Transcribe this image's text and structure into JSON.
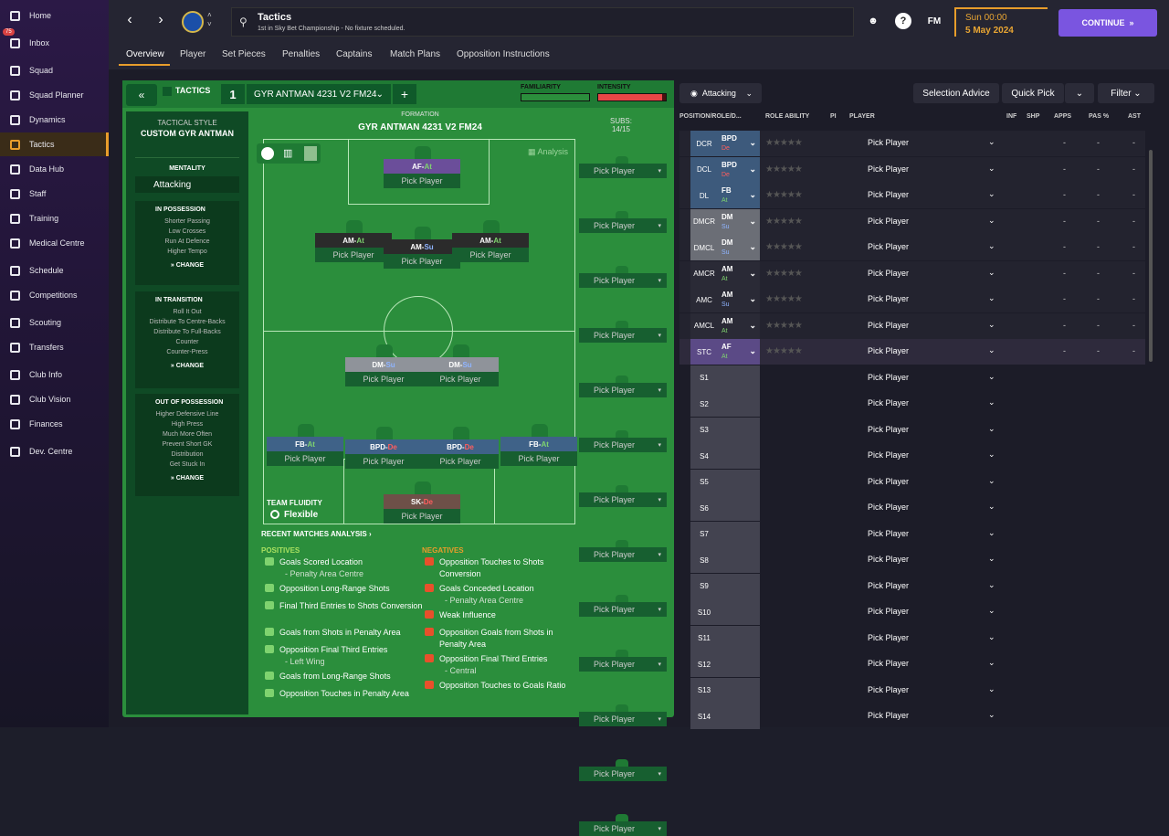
{
  "sidebar": {
    "items": [
      {
        "label": "Home",
        "icon": "home-icon",
        "active": false
      },
      {
        "label": "Inbox",
        "icon": "inbox-icon",
        "active": false,
        "badge": "75"
      },
      {
        "label": "Squad",
        "icon": "squad-icon",
        "active": false
      },
      {
        "label": "Squad Planner",
        "icon": "planner-icon",
        "active": false
      },
      {
        "label": "Dynamics",
        "icon": "dynamics-icon",
        "active": false
      },
      {
        "label": "Tactics",
        "icon": "tactics-icon",
        "active": true
      },
      {
        "label": "Data Hub",
        "icon": "data-hub-icon",
        "active": false
      },
      {
        "label": "Staff",
        "icon": "staff-icon",
        "active": false
      },
      {
        "label": "Training",
        "icon": "training-icon",
        "active": false
      },
      {
        "label": "Medical Centre",
        "icon": "medical-icon",
        "active": false
      },
      {
        "label": "Schedule",
        "icon": "schedule-icon",
        "active": false
      },
      {
        "label": "Competitions",
        "icon": "trophy-icon",
        "active": false
      },
      {
        "label": "Scouting",
        "icon": "scouting-icon",
        "active": false
      },
      {
        "label": "Transfers",
        "icon": "transfers-icon",
        "active": false
      },
      {
        "label": "Club Info",
        "icon": "club-info-icon",
        "active": false
      },
      {
        "label": "Club Vision",
        "icon": "club-vision-icon",
        "active": false
      },
      {
        "label": "Finances",
        "icon": "finances-icon",
        "active": false
      },
      {
        "label": "Dev. Centre",
        "icon": "dev-centre-icon",
        "active": false
      }
    ]
  },
  "header": {
    "title": "Tactics",
    "subtitle": "1st in Sky Bet Championship - No fixture scheduled.",
    "fm_label": "FM",
    "help_label": "?",
    "time": "Sun 00:00",
    "date": "5 May 2024",
    "continue_label": "CONTINUE"
  },
  "tabs": [
    "Overview",
    "Player",
    "Set Pieces",
    "Penalties",
    "Captains",
    "Match Plans",
    "Opposition Instructions"
  ],
  "tactic": {
    "label": "TACTICS",
    "slot": "1",
    "name": "GYR ANTMAN 4231 V2 FM24",
    "familiarity_label": "FAMILIARITY",
    "intensity_label": "INTENSITY",
    "intensity_level": 0.95,
    "style_label": "TACTICAL STYLE",
    "style_name": "CUSTOM GYR ANTMAN",
    "mentality_label": "MENTALITY",
    "mentality": "Attacking",
    "formation_label": "FORMATION",
    "subs_label": "SUBS:",
    "subs_count": "14/15",
    "analysis_label": "Analysis",
    "fluidity_label": "TEAM FLUIDITY",
    "fluidity": "Flexible",
    "change_label": "CHANGE"
  },
  "phases": [
    {
      "title": "IN POSSESSION",
      "items": [
        "Shorter Passing",
        "Low Crosses",
        "Run At Defence",
        "Higher Tempo"
      ]
    },
    {
      "title": "IN TRANSITION",
      "items": [
        "Roll It Out",
        "Distribute To Centre-Backs",
        "Distribute To Full-Backs",
        "Counter",
        "Counter-Press"
      ]
    },
    {
      "title": "OUT OF POSSESSION",
      "items": [
        "Higher Defensive Line",
        "High Press",
        "Much More Often",
        "Prevent Short GK",
        "Distribution",
        "Get Stuck In"
      ]
    }
  ],
  "pitch_players": [
    {
      "role": "AF",
      "duty": "At",
      "pick": "Pick Player"
    },
    {
      "role": "AM",
      "duty": "At",
      "pick": "Pick Player"
    },
    {
      "role": "AM",
      "duty": "Su",
      "pick": "Pick Player"
    },
    {
      "role": "AM",
      "duty": "At",
      "pick": "Pick Player"
    },
    {
      "role": "DM",
      "duty": "Su",
      "pick": "Pick Player"
    },
    {
      "role": "DM",
      "duty": "Su",
      "pick": "Pick Player"
    },
    {
      "role": "FB",
      "duty": "At",
      "pick": "Pick Player"
    },
    {
      "role": "BPD",
      "duty": "De",
      "pick": "Pick Player"
    },
    {
      "role": "BPD",
      "duty": "De",
      "pick": "Pick Player"
    },
    {
      "role": "FB",
      "duty": "At",
      "pick": "Pick Player"
    },
    {
      "role": "SK",
      "duty": "De",
      "pick": "Pick Player"
    }
  ],
  "subs": [
    "Pick Player",
    "Pick Player",
    "Pick Player",
    "Pick Player",
    "Pick Player",
    "Pick Player",
    "Pick Player",
    "Pick Player",
    "Pick Player",
    "Pick Player",
    "Pick Player",
    "Pick Player",
    "Pick Player"
  ],
  "analysis": {
    "title": "RECENT MATCHES ANALYSIS",
    "positives_label": "POSITIVES",
    "negatives_label": "NEGATIVES",
    "positives": [
      {
        "text": "Goals Scored Location",
        "detail": "- Penalty Area Centre"
      },
      {
        "text": "Opposition Long-Range Shots",
        "detail": ""
      },
      {
        "text": "Final Third Entries to Shots Conversion",
        "detail": ""
      },
      {
        "text": "Goals from Shots in Penalty Area",
        "detail": ""
      },
      {
        "text": "Opposition Final Third Entries",
        "detail": "- Left Wing"
      },
      {
        "text": "Goals from Long-Range Shots",
        "detail": ""
      },
      {
        "text": "Opposition Touches in Penalty Area",
        "detail": ""
      }
    ],
    "negatives": [
      {
        "text": "Opposition Touches to Shots Conversion",
        "detail": ""
      },
      {
        "text": "Goals Conceded Location",
        "detail": "- Penalty Area Centre"
      },
      {
        "text": "Weak Influence",
        "detail": ""
      },
      {
        "text": "Opposition Goals from Shots in Penalty Area",
        "detail": ""
      },
      {
        "text": "Opposition Final Third Entries",
        "detail": "- Central"
      },
      {
        "text": "Opposition Touches to Goals Ratio",
        "detail": ""
      }
    ]
  },
  "right": {
    "mentality_label": "Attacking",
    "selection_advice": "Selection Advice",
    "quick_pick": "Quick Pick",
    "filter": "Filter",
    "columns": [
      "POSITION/ROLE/D...",
      "ROLE ABILITY",
      "PI",
      "PLAYER",
      "INF",
      "SHP",
      "APPS",
      "PAS %",
      "AST"
    ],
    "rows": [
      {
        "pos": "DCR",
        "role": "BPD",
        "duty": "De",
        "player": "Pick Player"
      },
      {
        "pos": "DCL",
        "role": "BPD",
        "duty": "De",
        "player": "Pick Player"
      },
      {
        "pos": "DL",
        "role": "FB",
        "duty": "At",
        "player": "Pick Player"
      },
      {
        "pos": "DMCR",
        "role": "DM",
        "duty": "Su",
        "player": "Pick Player"
      },
      {
        "pos": "DMCL",
        "role": "DM",
        "duty": "Su",
        "player": "Pick Player"
      },
      {
        "pos": "AMCR",
        "role": "AM",
        "duty": "At",
        "player": "Pick Player"
      },
      {
        "pos": "AMC",
        "role": "AM",
        "duty": "Su",
        "player": "Pick Player"
      },
      {
        "pos": "AMCL",
        "role": "AM",
        "duty": "At",
        "player": "Pick Player"
      },
      {
        "pos": "STC",
        "role": "AF",
        "duty": "At",
        "player": "Pick Player"
      },
      {
        "pos": "S1",
        "role": "",
        "duty": "",
        "player": "Pick Player"
      },
      {
        "pos": "S2",
        "role": "",
        "duty": "",
        "player": "Pick Player"
      },
      {
        "pos": "S3",
        "role": "",
        "duty": "",
        "player": "Pick Player"
      },
      {
        "pos": "S4",
        "role": "",
        "duty": "",
        "player": "Pick Player"
      },
      {
        "pos": "S5",
        "role": "",
        "duty": "",
        "player": "Pick Player"
      },
      {
        "pos": "S6",
        "role": "",
        "duty": "",
        "player": "Pick Player"
      },
      {
        "pos": "S7",
        "role": "",
        "duty": "",
        "player": "Pick Player"
      },
      {
        "pos": "S8",
        "role": "",
        "duty": "",
        "player": "Pick Player"
      },
      {
        "pos": "S9",
        "role": "",
        "duty": "",
        "player": "Pick Player"
      },
      {
        "pos": "S10",
        "role": "",
        "duty": "",
        "player": "Pick Player"
      },
      {
        "pos": "S11",
        "role": "",
        "duty": "",
        "player": "Pick Player"
      },
      {
        "pos": "S12",
        "role": "",
        "duty": "",
        "player": "Pick Player"
      },
      {
        "pos": "S13",
        "role": "",
        "duty": "",
        "player": "Pick Player"
      },
      {
        "pos": "S14",
        "role": "",
        "duty": "",
        "player": "Pick Player"
      }
    ],
    "dash": "-"
  },
  "colors": {
    "accent": "#e89d2b",
    "continue": "#7a55e0",
    "pitch": "#2b8e3c"
  }
}
